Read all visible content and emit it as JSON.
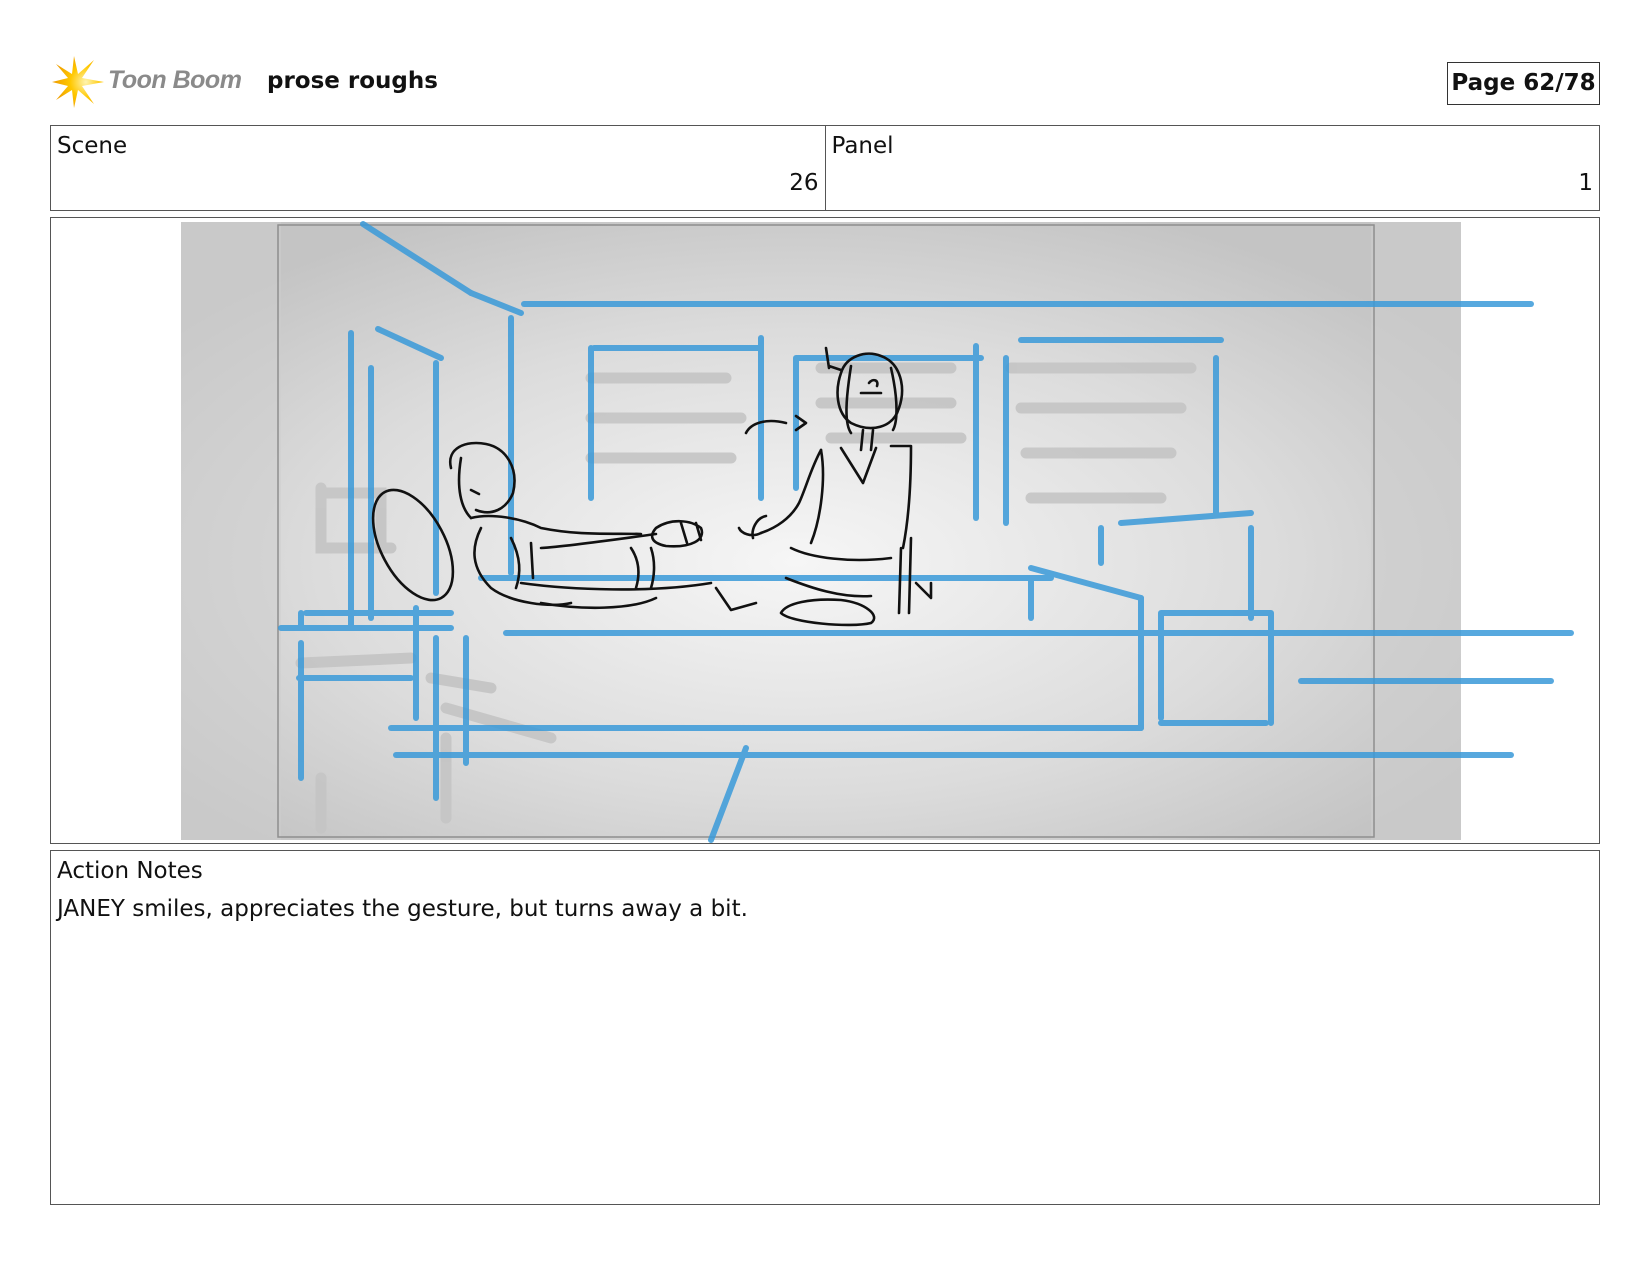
{
  "header": {
    "logo_text": "Toon Boom",
    "project_title": "prose roughs",
    "page_indicator": "Page 62/78"
  },
  "fields": {
    "scene_label": "Scene",
    "scene_value": "26",
    "panel_label": "Panel",
    "panel_value": "1"
  },
  "notes": {
    "label": "Action Notes",
    "text": "JANEY smiles, appreciates the gesture, but turns away a bit."
  },
  "colors": {
    "logo_accent": "#f5b800",
    "sketch_blue": "#3a9ad9",
    "sketch_ink": "#111111"
  }
}
